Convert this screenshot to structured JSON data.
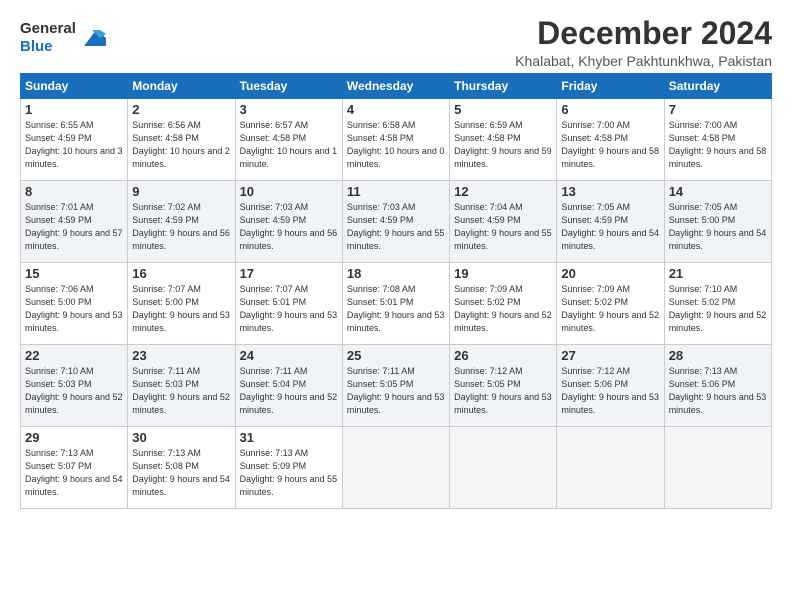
{
  "logo": {
    "general": "General",
    "blue": "Blue"
  },
  "title": "December 2024",
  "location": "Khalabat, Khyber Pakhtunkhwa, Pakistan",
  "headers": [
    "Sunday",
    "Monday",
    "Tuesday",
    "Wednesday",
    "Thursday",
    "Friday",
    "Saturday"
  ],
  "weeks": [
    [
      {
        "day": "1",
        "sunrise": "Sunrise: 6:55 AM",
        "sunset": "Sunset: 4:59 PM",
        "daylight": "Daylight: 10 hours and 3 minutes."
      },
      {
        "day": "2",
        "sunrise": "Sunrise: 6:56 AM",
        "sunset": "Sunset: 4:58 PM",
        "daylight": "Daylight: 10 hours and 2 minutes."
      },
      {
        "day": "3",
        "sunrise": "Sunrise: 6:57 AM",
        "sunset": "Sunset: 4:58 PM",
        "daylight": "Daylight: 10 hours and 1 minute."
      },
      {
        "day": "4",
        "sunrise": "Sunrise: 6:58 AM",
        "sunset": "Sunset: 4:58 PM",
        "daylight": "Daylight: 10 hours and 0 minutes."
      },
      {
        "day": "5",
        "sunrise": "Sunrise: 6:59 AM",
        "sunset": "Sunset: 4:58 PM",
        "daylight": "Daylight: 9 hours and 59 minutes."
      },
      {
        "day": "6",
        "sunrise": "Sunrise: 7:00 AM",
        "sunset": "Sunset: 4:58 PM",
        "daylight": "Daylight: 9 hours and 58 minutes."
      },
      {
        "day": "7",
        "sunrise": "Sunrise: 7:00 AM",
        "sunset": "Sunset: 4:58 PM",
        "daylight": "Daylight: 9 hours and 58 minutes."
      }
    ],
    [
      {
        "day": "8",
        "sunrise": "Sunrise: 7:01 AM",
        "sunset": "Sunset: 4:59 PM",
        "daylight": "Daylight: 9 hours and 57 minutes."
      },
      {
        "day": "9",
        "sunrise": "Sunrise: 7:02 AM",
        "sunset": "Sunset: 4:59 PM",
        "daylight": "Daylight: 9 hours and 56 minutes."
      },
      {
        "day": "10",
        "sunrise": "Sunrise: 7:03 AM",
        "sunset": "Sunset: 4:59 PM",
        "daylight": "Daylight: 9 hours and 56 minutes."
      },
      {
        "day": "11",
        "sunrise": "Sunrise: 7:03 AM",
        "sunset": "Sunset: 4:59 PM",
        "daylight": "Daylight: 9 hours and 55 minutes."
      },
      {
        "day": "12",
        "sunrise": "Sunrise: 7:04 AM",
        "sunset": "Sunset: 4:59 PM",
        "daylight": "Daylight: 9 hours and 55 minutes."
      },
      {
        "day": "13",
        "sunrise": "Sunrise: 7:05 AM",
        "sunset": "Sunset: 4:59 PM",
        "daylight": "Daylight: 9 hours and 54 minutes."
      },
      {
        "day": "14",
        "sunrise": "Sunrise: 7:05 AM",
        "sunset": "Sunset: 5:00 PM",
        "daylight": "Daylight: 9 hours and 54 minutes."
      }
    ],
    [
      {
        "day": "15",
        "sunrise": "Sunrise: 7:06 AM",
        "sunset": "Sunset: 5:00 PM",
        "daylight": "Daylight: 9 hours and 53 minutes."
      },
      {
        "day": "16",
        "sunrise": "Sunrise: 7:07 AM",
        "sunset": "Sunset: 5:00 PM",
        "daylight": "Daylight: 9 hours and 53 minutes."
      },
      {
        "day": "17",
        "sunrise": "Sunrise: 7:07 AM",
        "sunset": "Sunset: 5:01 PM",
        "daylight": "Daylight: 9 hours and 53 minutes."
      },
      {
        "day": "18",
        "sunrise": "Sunrise: 7:08 AM",
        "sunset": "Sunset: 5:01 PM",
        "daylight": "Daylight: 9 hours and 53 minutes."
      },
      {
        "day": "19",
        "sunrise": "Sunrise: 7:09 AM",
        "sunset": "Sunset: 5:02 PM",
        "daylight": "Daylight: 9 hours and 52 minutes."
      },
      {
        "day": "20",
        "sunrise": "Sunrise: 7:09 AM",
        "sunset": "Sunset: 5:02 PM",
        "daylight": "Daylight: 9 hours and 52 minutes."
      },
      {
        "day": "21",
        "sunrise": "Sunrise: 7:10 AM",
        "sunset": "Sunset: 5:02 PM",
        "daylight": "Daylight: 9 hours and 52 minutes."
      }
    ],
    [
      {
        "day": "22",
        "sunrise": "Sunrise: 7:10 AM",
        "sunset": "Sunset: 5:03 PM",
        "daylight": "Daylight: 9 hours and 52 minutes."
      },
      {
        "day": "23",
        "sunrise": "Sunrise: 7:11 AM",
        "sunset": "Sunset: 5:03 PM",
        "daylight": "Daylight: 9 hours and 52 minutes."
      },
      {
        "day": "24",
        "sunrise": "Sunrise: 7:11 AM",
        "sunset": "Sunset: 5:04 PM",
        "daylight": "Daylight: 9 hours and 52 minutes."
      },
      {
        "day": "25",
        "sunrise": "Sunrise: 7:11 AM",
        "sunset": "Sunset: 5:05 PM",
        "daylight": "Daylight: 9 hours and 53 minutes."
      },
      {
        "day": "26",
        "sunrise": "Sunrise: 7:12 AM",
        "sunset": "Sunset: 5:05 PM",
        "daylight": "Daylight: 9 hours and 53 minutes."
      },
      {
        "day": "27",
        "sunrise": "Sunrise: 7:12 AM",
        "sunset": "Sunset: 5:06 PM",
        "daylight": "Daylight: 9 hours and 53 minutes."
      },
      {
        "day": "28",
        "sunrise": "Sunrise: 7:13 AM",
        "sunset": "Sunset: 5:06 PM",
        "daylight": "Daylight: 9 hours and 53 minutes."
      }
    ],
    [
      {
        "day": "29",
        "sunrise": "Sunrise: 7:13 AM",
        "sunset": "Sunset: 5:07 PM",
        "daylight": "Daylight: 9 hours and 54 minutes."
      },
      {
        "day": "30",
        "sunrise": "Sunrise: 7:13 AM",
        "sunset": "Sunset: 5:08 PM",
        "daylight": "Daylight: 9 hours and 54 minutes."
      },
      {
        "day": "31",
        "sunrise": "Sunrise: 7:13 AM",
        "sunset": "Sunset: 5:09 PM",
        "daylight": "Daylight: 9 hours and 55 minutes."
      },
      null,
      null,
      null,
      null
    ]
  ]
}
